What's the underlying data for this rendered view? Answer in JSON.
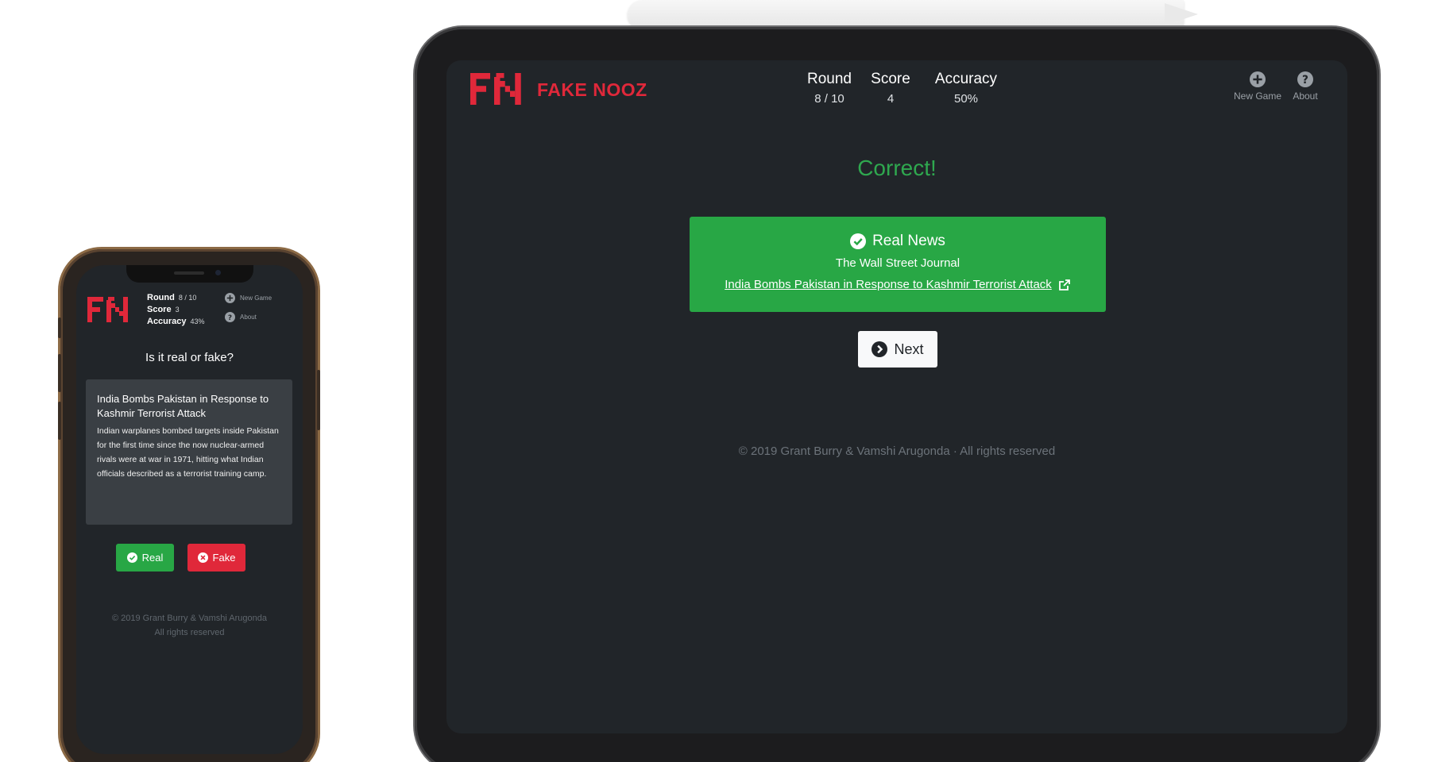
{
  "brand": {
    "name": "FAKE NOOZ",
    "logo_color": "#e0283a"
  },
  "colors": {
    "bg": "#212529",
    "real": "#28a745",
    "fake": "#e0283a",
    "card": "#3a3f44"
  },
  "phone": {
    "stats": {
      "round_label": "Round",
      "round_value": "8 / 10",
      "score_label": "Score",
      "score_value": "3",
      "accuracy_label": "Accuracy",
      "accuracy_value": "43%"
    },
    "nav": {
      "new_game": "New Game",
      "about": "About"
    },
    "question": "Is it real or fake?",
    "article": {
      "headline": "India Bombs Pakistan in Response to Kashmir Terrorist Attack",
      "summary": "Indian warplanes bombed targets inside Pakistan for the first time since the now nuclear-armed rivals were at war in 1971, hitting what Indian officials described as a terrorist training camp."
    },
    "buttons": {
      "real": "Real",
      "fake": "Fake"
    },
    "footer_line1": "© 2019 Grant Burry & Vamshi Arugonda",
    "footer_line2": "All rights reserved"
  },
  "tablet": {
    "stats": {
      "round_label": "Round",
      "round_value": "8 / 10",
      "score_label": "Score",
      "score_value": "4",
      "accuracy_label": "Accuracy",
      "accuracy_value": "50%"
    },
    "nav": {
      "new_game": "New Game",
      "about": "About"
    },
    "result": "Correct!",
    "answer": {
      "verdict": "Real News",
      "source": "The Wall Street Journal",
      "link_text": "India Bombs Pakistan in Response to Kashmir Terrorist Attack"
    },
    "next_label": "Next",
    "footer": "© 2019 Grant Burry & Vamshi Arugonda  ·  All rights reserved"
  },
  "icons": [
    "fn-logo-icon",
    "plus-circle-icon",
    "question-circle-icon",
    "check-circle-icon",
    "times-circle-icon",
    "external-link-icon",
    "arrow-right-circle-icon"
  ]
}
